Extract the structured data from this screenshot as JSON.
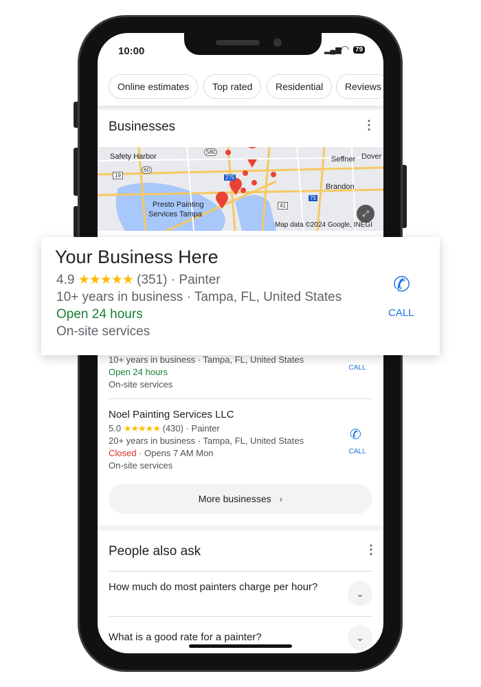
{
  "status_bar": {
    "time": "10:00",
    "battery": "79"
  },
  "chips": [
    "Online estimates",
    "Top rated",
    "Residential",
    "Reviews"
  ],
  "businesses": {
    "title": "Businesses",
    "map": {
      "labels": [
        "Safety Harbor",
        "Seffner",
        "Dover",
        "Brandon",
        "Presto Painting",
        "Services Tampa"
      ],
      "shields": [
        "580",
        "19",
        "60",
        "275",
        "75",
        "41"
      ],
      "attribution": "Map data ©2024 Google, INEGI"
    },
    "featured": {
      "name": "Your Business Here",
      "rating": "4.9",
      "stars": "★★★★★",
      "reviews": "(351)",
      "category": "· Painter",
      "details": "10+ years in business · Tampa, FL, United States",
      "hours": "Open 24 hours",
      "services": "On-site services",
      "call": "CALL"
    },
    "partial": {
      "details": "10+ years in business · Tampa, FL, United States",
      "hours": "Open 24 hours",
      "services": "On-site services",
      "call": "CALL"
    },
    "items": [
      {
        "name": "Noel Painting Services LLC",
        "rating": "5.0",
        "stars": "★★★★★",
        "reviews": "(430)",
        "category": "· Painter",
        "details": "20+ years in business · Tampa, FL, United States",
        "status": "Closed",
        "opens": "· Opens 7 AM Mon",
        "services": "On-site services",
        "call": "CALL"
      }
    ],
    "more": "More businesses"
  },
  "paa": {
    "title": "People also ask",
    "questions": [
      "How much do most painters charge per hour?",
      "What is a good rate for a painter?"
    ]
  },
  "colors": {
    "call": "#1a73e8",
    "open": "#188038",
    "closed": "#d93025",
    "star": "#fbbc04",
    "pin": "#ea4335"
  }
}
